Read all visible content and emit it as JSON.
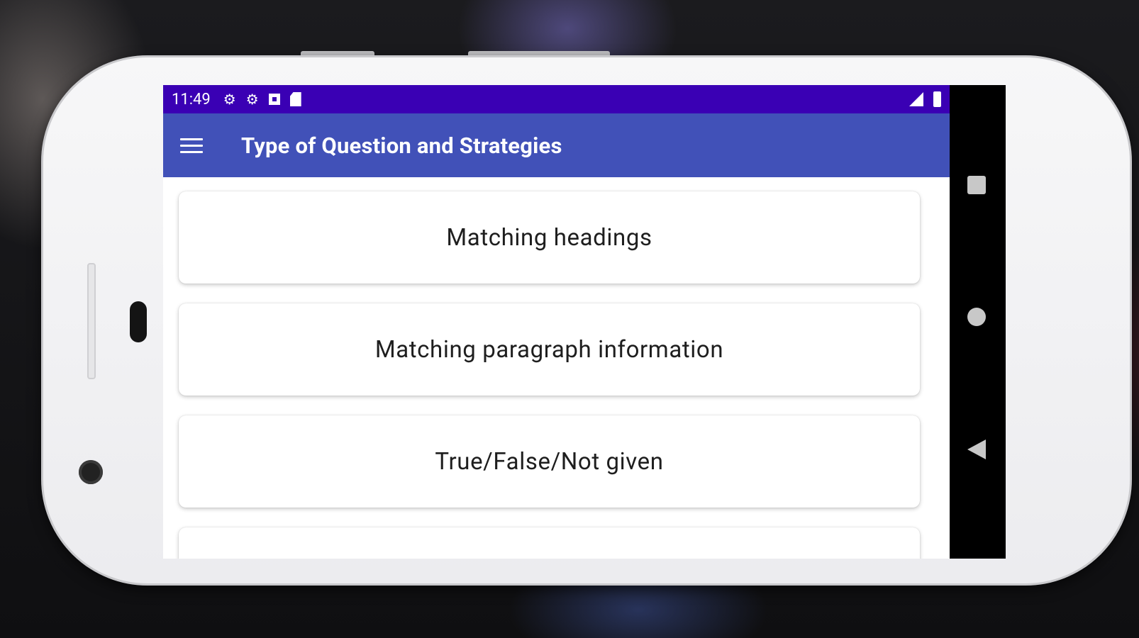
{
  "status_bar": {
    "time": "11:49",
    "left_icons": [
      "settings-icon",
      "settings-icon",
      "notification-icon",
      "sd-card-icon"
    ],
    "right_icons": [
      "signal-icon",
      "battery-icon"
    ],
    "color": "#3a00b4"
  },
  "app_bar": {
    "title": "Type of Question and Strategies",
    "menu_icon": "hamburger-menu-icon",
    "color": "#4151b8"
  },
  "list": {
    "items": [
      {
        "label": "Matching headings"
      },
      {
        "label": "Matching paragraph information"
      },
      {
        "label": "True/False/Not given"
      },
      {
        "label": ""
      }
    ]
  },
  "nav_bar": {
    "buttons": [
      "recent-apps-icon",
      "home-icon",
      "back-icon"
    ]
  }
}
